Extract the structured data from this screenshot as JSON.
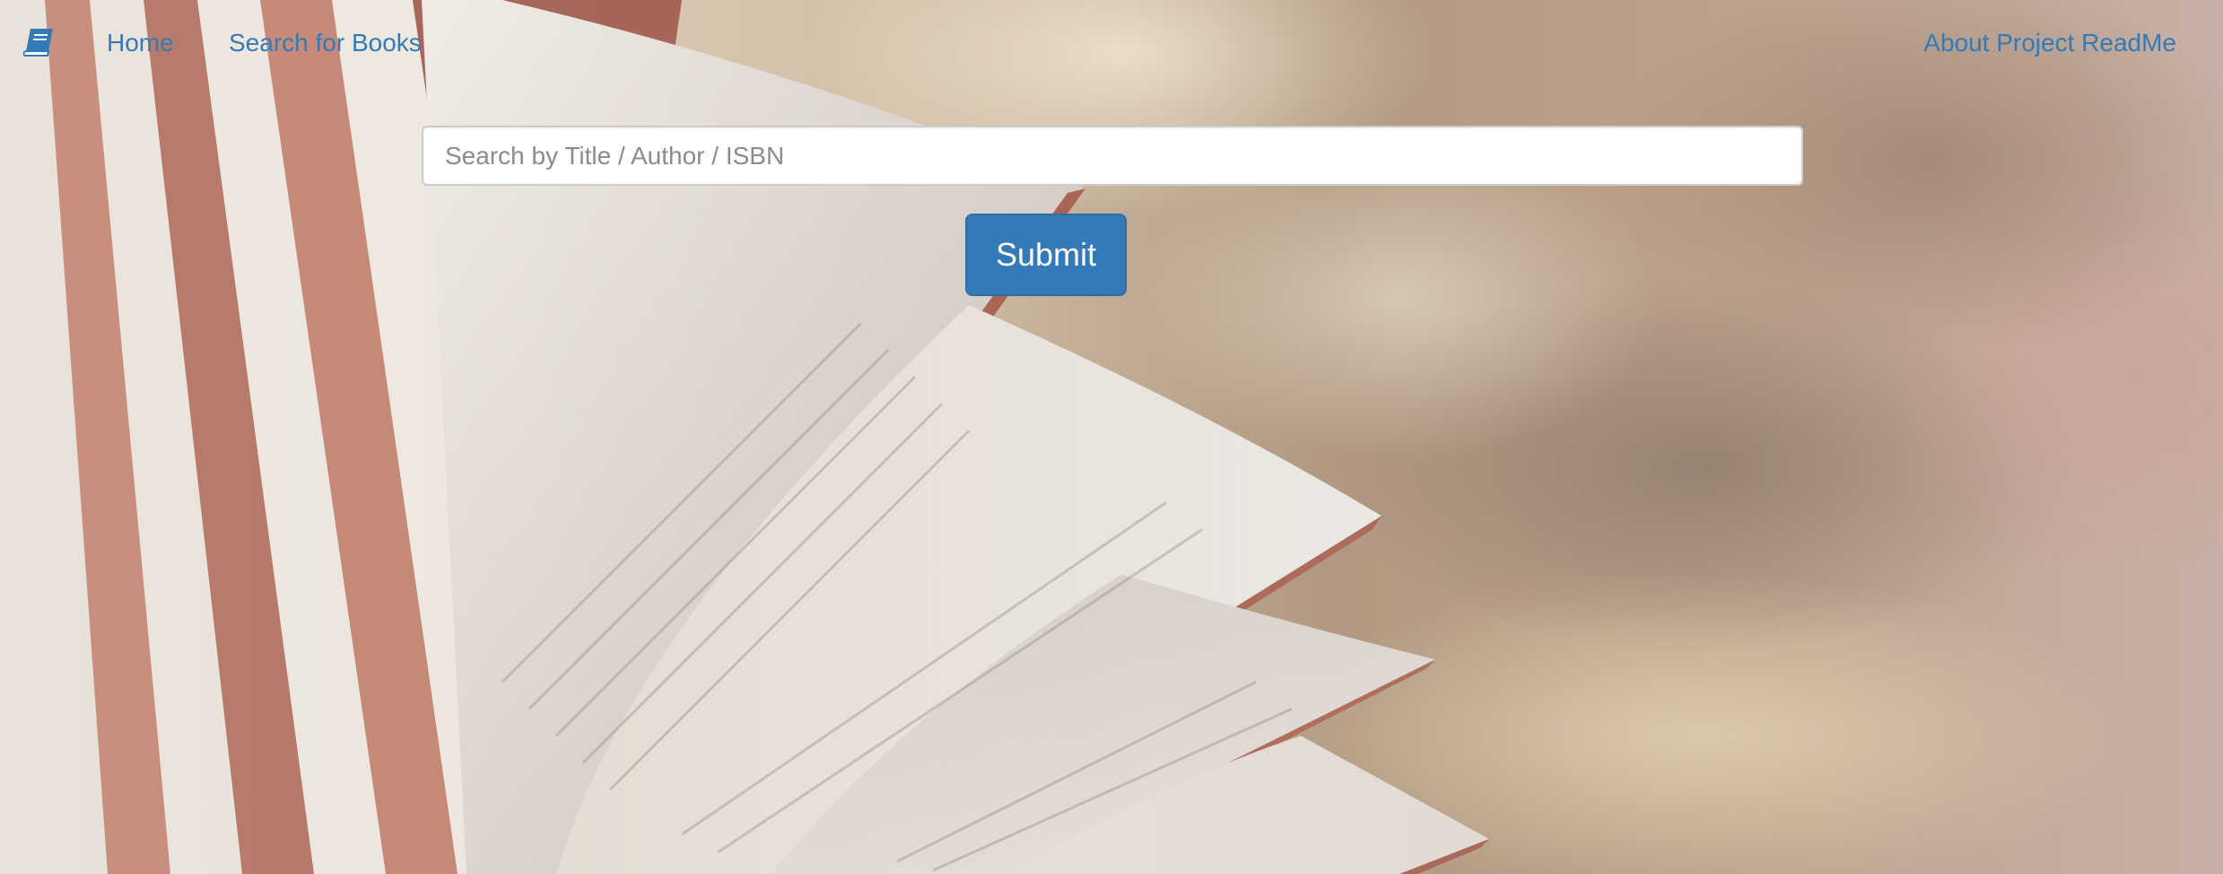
{
  "nav": {
    "brand_icon": "book-icon",
    "home_label": "Home",
    "search_label": "Search for Books",
    "about_label": "About Project ReadMe"
  },
  "search": {
    "value": "",
    "placeholder": "Search by Title / Author / ISBN",
    "submit_label": "Submit"
  },
  "colors": {
    "link": "#337ab7",
    "button_bg": "#337ab7",
    "button_border": "#2e6da4",
    "button_text": "#ffffff"
  },
  "background": {
    "description_icon": "open-book-photo"
  }
}
